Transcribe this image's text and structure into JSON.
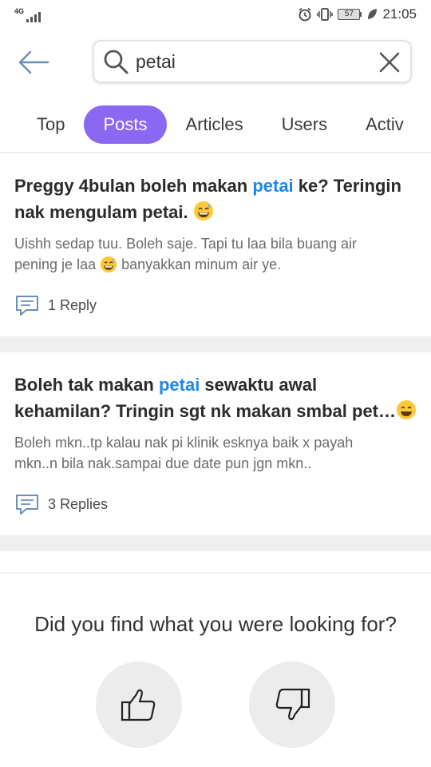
{
  "status_bar": {
    "network": "4G",
    "battery": "57",
    "time": "21:05"
  },
  "search": {
    "query": "petai",
    "placeholder": ""
  },
  "tabs": [
    {
      "label": "Top",
      "active": false
    },
    {
      "label": "Posts",
      "active": true
    },
    {
      "label": "Articles",
      "active": false
    },
    {
      "label": "Users",
      "active": false
    },
    {
      "label": "Activ",
      "active": false
    }
  ],
  "posts": [
    {
      "title_before": "Preggy 4bulan boleh makan ",
      "title_highlight": "petai",
      "title_line1_after": " ke? Teringin",
      "title_line2": "nak mengulam petai. ",
      "excerpt_line1": "Uishh sedap tuu. Boleh saje. Tapi tu laa bila buang air",
      "excerpt_line2_before": "pening je laa ",
      "excerpt_line2_after": " banyakkan minum air ye.",
      "replies": "1 Reply"
    },
    {
      "title_before": "Boleh tak makan ",
      "title_highlight": "petai",
      "title_line1_after": " sewaktu awal",
      "title_line2": "kehamilan?  Tringin sgt nk makan smbal pet…",
      "excerpt_line1": "Boleh mkn..tp kalau nak pi klinik esknya baik x payah",
      "excerpt_line2_before": "mkn..n bila nak.sampai due date pun jgn mkn..",
      "excerpt_line2_after": "",
      "replies": "3 Replies"
    }
  ],
  "feedback": {
    "question": "Did you find what you were looking for?"
  },
  "colors": {
    "accent": "#8b68f2",
    "highlight": "#1e88e5",
    "divider": "#efefef"
  },
  "icons": [
    "back-arrow-icon",
    "search-icon",
    "clear-icon",
    "comment-icon",
    "thumbs-up-icon",
    "thumbs-down-icon",
    "grinning-sweat-emoji"
  ]
}
